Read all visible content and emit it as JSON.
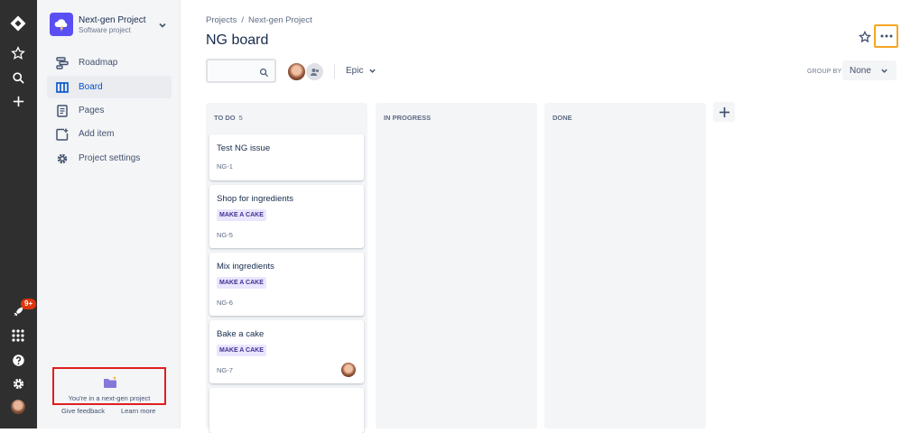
{
  "sidebar": {
    "project_name": "Next-gen Project",
    "project_type": "Software project",
    "items": [
      {
        "label": "Roadmap",
        "icon": "roadmap-icon"
      },
      {
        "label": "Board",
        "icon": "board-icon",
        "active": true
      },
      {
        "label": "Pages",
        "icon": "pages-icon"
      },
      {
        "label": "Add item",
        "icon": "add-item-icon"
      },
      {
        "label": "Project settings",
        "icon": "gear-icon"
      }
    ],
    "nextgen_text": "You're in a next-gen project",
    "give_feedback": "Give feedback",
    "learn_more": "Learn more"
  },
  "rail": {
    "notification_badge": "9+",
    "icons": [
      "jira-logo-icon",
      "star-icon",
      "search-icon",
      "create-icon",
      "notification-rocket-icon",
      "apps-grid-icon",
      "help-icon",
      "settings-icon",
      "user-avatar"
    ]
  },
  "header": {
    "breadcrumb": [
      "Projects",
      "Next-gen Project"
    ],
    "title": "NG board"
  },
  "toolbar": {
    "search_placeholder": "",
    "epic_label": "Epic",
    "group_by_label": "GROUP BY",
    "group_by_value": "None"
  },
  "board": {
    "columns": [
      {
        "name": "TO DO",
        "count": "5",
        "cards": [
          {
            "title": "Test NG issue",
            "epic": "",
            "key": "NG-1"
          },
          {
            "title": "Shop for ingredients",
            "epic": "MAKE A CAKE",
            "key": "NG-5"
          },
          {
            "title": "Mix ingredients",
            "epic": "MAKE A CAKE",
            "key": "NG-6"
          },
          {
            "title": "Bake a cake",
            "epic": "MAKE A CAKE",
            "key": "NG-7"
          }
        ]
      },
      {
        "name": "IN PROGRESS",
        "count": "",
        "cards": []
      },
      {
        "name": "DONE",
        "count": "",
        "cards": []
      }
    ]
  },
  "colors": {
    "rail_bg": "#2f2f2f",
    "sidebar_bg": "#f4f5f7",
    "accent": "#0052cc",
    "epic_bg": "#eae6ff",
    "epic_text": "#403294",
    "highlight_red": "#e01e1e",
    "highlight_orange": "#f5a623"
  }
}
